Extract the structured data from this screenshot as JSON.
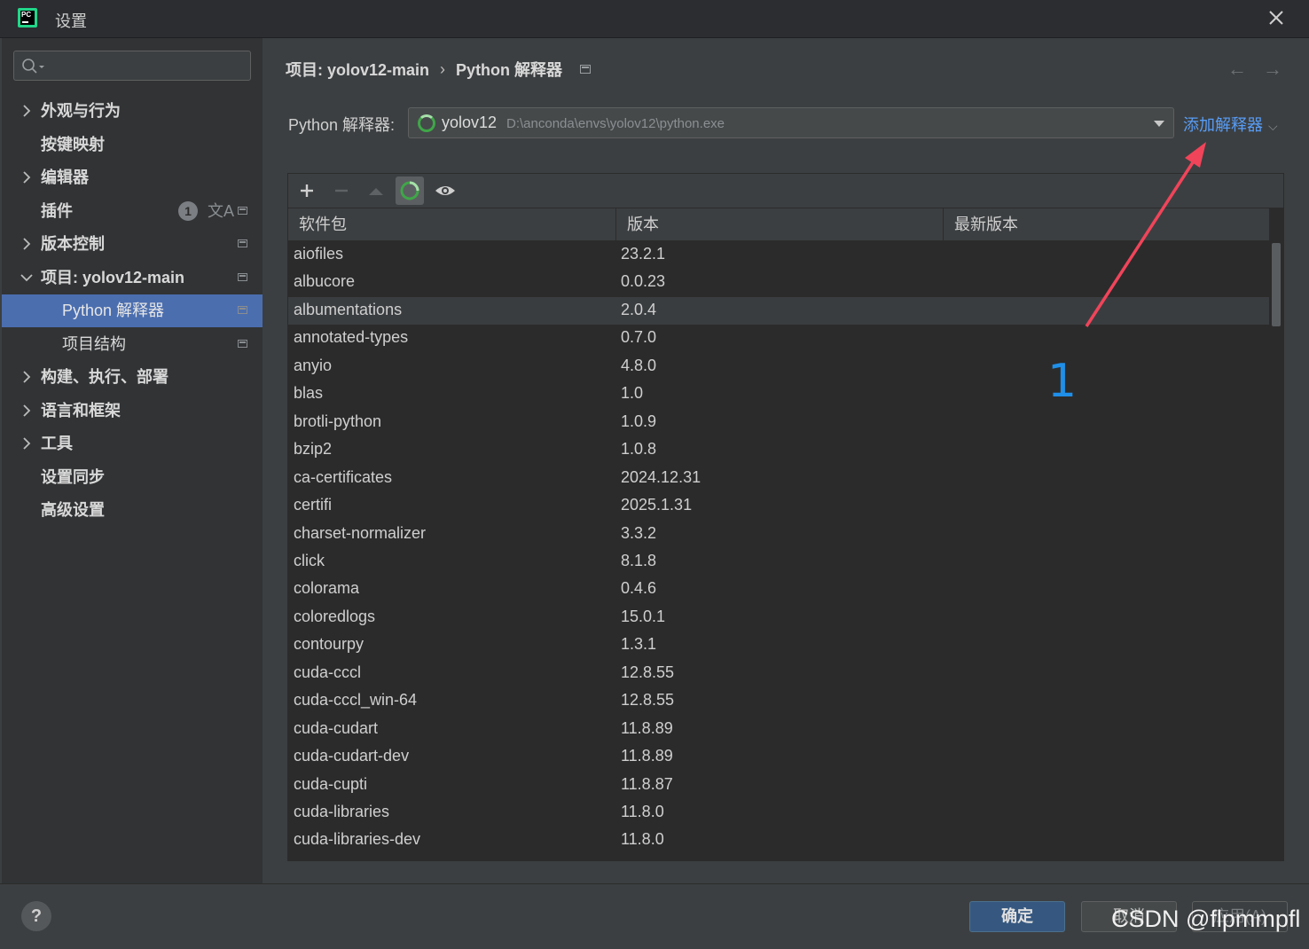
{
  "window": {
    "title": "设置",
    "logo_text": "PC"
  },
  "sidebar": {
    "items": [
      {
        "label": "外观与行为"
      },
      {
        "label": "按键映射"
      },
      {
        "label": "编辑器"
      },
      {
        "label": "插件",
        "badge": "1",
        "extra_icon": "文A"
      },
      {
        "label": "版本控制"
      },
      {
        "label": "项目: yolov12-main"
      },
      {
        "label": "Python 解释器"
      },
      {
        "label": "项目结构"
      },
      {
        "label": "构建、执行、部署"
      },
      {
        "label": "语言和框架"
      },
      {
        "label": "工具"
      },
      {
        "label": "设置同步"
      },
      {
        "label": "高级设置"
      }
    ]
  },
  "breadcrumb": {
    "project": "项目: yolov12-main",
    "separator": "›",
    "page": "Python 解释器"
  },
  "interpreter": {
    "label": "Python 解释器:",
    "name": "yolov12",
    "path": "D:\\anconda\\envs\\yolov12\\python.exe",
    "add_label": "添加解释器"
  },
  "table": {
    "headers": [
      "软件包",
      "版本",
      "最新版本"
    ],
    "rows": [
      {
        "name": "aiofiles",
        "version": "23.2.1"
      },
      {
        "name": "albucore",
        "version": "0.0.23"
      },
      {
        "name": "albumentations",
        "version": "2.0.4"
      },
      {
        "name": "annotated-types",
        "version": "0.7.0"
      },
      {
        "name": "anyio",
        "version": "4.8.0"
      },
      {
        "name": "blas",
        "version": "1.0"
      },
      {
        "name": "brotli-python",
        "version": "1.0.9"
      },
      {
        "name": "bzip2",
        "version": "1.0.8"
      },
      {
        "name": "ca-certificates",
        "version": "2024.12.31"
      },
      {
        "name": "certifi",
        "version": "2025.1.31"
      },
      {
        "name": "charset-normalizer",
        "version": "3.3.2"
      },
      {
        "name": "click",
        "version": "8.1.8"
      },
      {
        "name": "colorama",
        "version": "0.4.6"
      },
      {
        "name": "coloredlogs",
        "version": "15.0.1"
      },
      {
        "name": "contourpy",
        "version": "1.3.1"
      },
      {
        "name": "cuda-cccl",
        "version": "12.8.55"
      },
      {
        "name": "cuda-cccl_win-64",
        "version": "12.8.55"
      },
      {
        "name": "cuda-cudart",
        "version": "11.8.89"
      },
      {
        "name": "cuda-cudart-dev",
        "version": "11.8.89"
      },
      {
        "name": "cuda-cupti",
        "version": "11.8.87"
      },
      {
        "name": "cuda-libraries",
        "version": "11.8.0"
      },
      {
        "name": "cuda-libraries-dev",
        "version": "11.8.0"
      }
    ]
  },
  "annotation": {
    "number": "1",
    "color": "#1f8fe8",
    "arrow_color": "#f0445a"
  },
  "footer": {
    "help": "?",
    "ok": "确定",
    "cancel": "取消",
    "apply": "应用(A)"
  },
  "watermark": "CSDN @flpmmpfl",
  "colors": {
    "selected": "#4b6eaf",
    "link": "#589df6",
    "ok_button": "#365880"
  }
}
